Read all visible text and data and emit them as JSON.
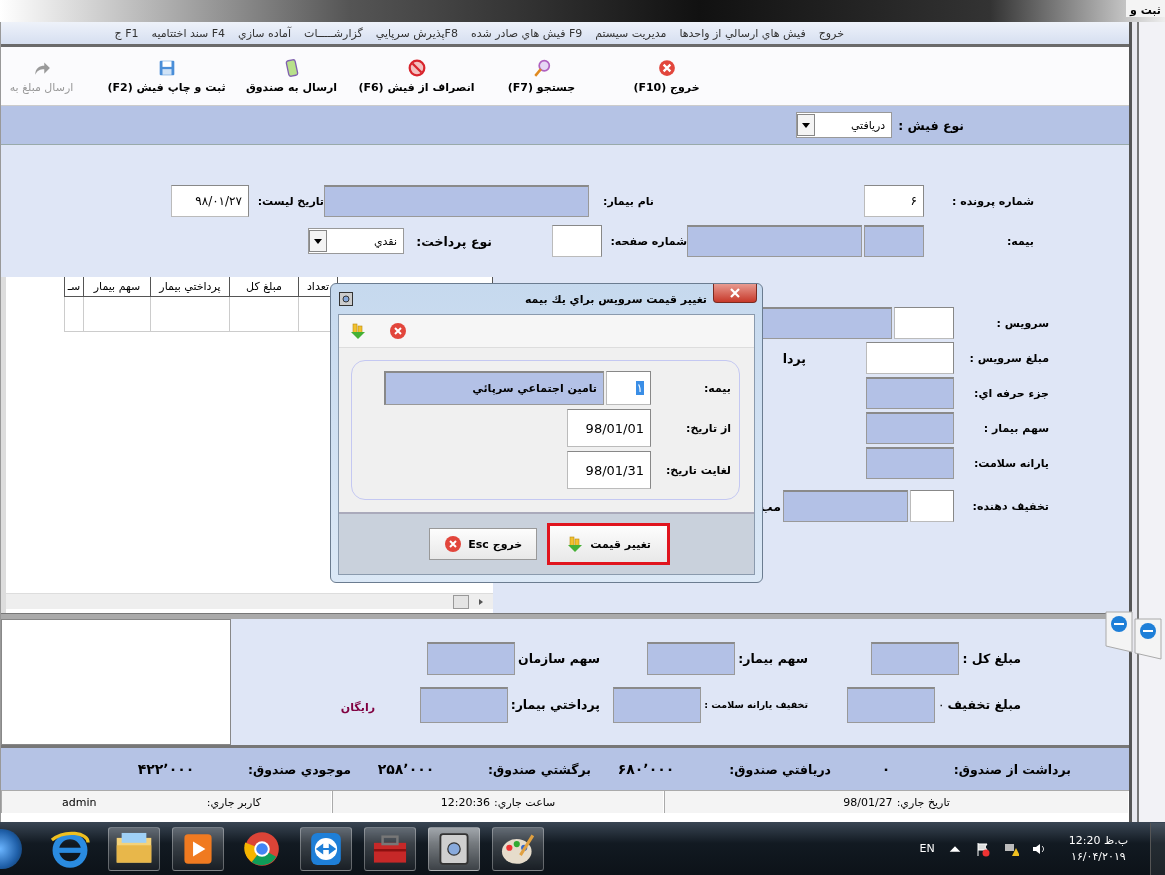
{
  "window": {
    "title": "ثبت و"
  },
  "menu": [
    "خروج",
    "فيش هاي ارسالي از واحدها",
    "مديريت سيستم",
    "F9 فيش هاي صادر شده",
    "F8پذيرش سرپايي",
    "گزارشـــــات",
    "آماده سازي",
    "F4 سند اختتاميه",
    "F1 ج"
  ],
  "toolbar": [
    {
      "label": "خروج (F10)",
      "kind": "exit",
      "disabled": false
    },
    {
      "label": "جستجو (F7)",
      "kind": "search",
      "disabled": false
    },
    {
      "label": "انصراف از فيش (F6)",
      "kind": "cancel",
      "disabled": false
    },
    {
      "label": "ارسال به صندوق",
      "kind": "send",
      "disabled": false
    },
    {
      "label": "ثبت و چاپ فيش (F2)",
      "kind": "save",
      "disabled": false
    },
    {
      "label": "ارسال مبلغ به",
      "kind": "forward",
      "disabled": true
    }
  ],
  "receipt_type": {
    "label": "نوع فيش :",
    "value": "دريافتي"
  },
  "patient": {
    "file_number": {
      "label": "شماره پرونده :",
      "value": "۶"
    },
    "name": {
      "label": "نام بيمار:"
    },
    "list_date": {
      "label": "تاريخ ليست:",
      "value": "۹۸/۰۱/۲۷"
    },
    "insurance": {
      "label": "بيمه:"
    },
    "page_number": {
      "label": "شماره صفحه:"
    },
    "payment_type": {
      "label": "نوع پرداخت:",
      "value": "نقدي"
    }
  },
  "grid": {
    "columns": [
      "تعداد",
      "مبلغ كل",
      "پرداختي بيمار",
      "سهم بيمار",
      "سـ"
    ]
  },
  "service": [
    {
      "label": "سرويس :",
      "kind": "code_name"
    },
    {
      "label": "مبلغ سرويس :",
      "kind": "input",
      "side_text": "پردا"
    },
    {
      "label": "جزء حرفه اي:",
      "kind": "readonly"
    },
    {
      "label": "سهم بيمار :",
      "kind": "readonly"
    },
    {
      "label": "يارانه سلامت:",
      "kind": "readonly"
    },
    {
      "label": "تخفيف دهنده:",
      "kind": "code_name",
      "side_text": "مب"
    }
  ],
  "dialog": {
    "title": "تغيير قيمت سرويس براي يك بيمه",
    "insurance": {
      "label": "بيمه:",
      "code": "۱",
      "code_highlighted": true,
      "name": "تامين اجتماعي سرپائي"
    },
    "from_date": {
      "label": "از تاريخ:",
      "value": "98/01/01"
    },
    "to_date": {
      "label": "لغايت تاريخ:",
      "value": "98/01/31"
    },
    "buttons": [
      {
        "label": "تغيير قيمت",
        "kind": "apply",
        "highlighted": true
      },
      {
        "label": "خروج Esc",
        "kind": "exit",
        "highlighted": false
      }
    ]
  },
  "totals": [
    {
      "label": "مبلغ كل :"
    },
    {
      "label": "سهم بيمار:"
    },
    {
      "label": "سهم سازمان"
    },
    {
      "label": "مبلغ تخفيف",
      "value": "۰"
    },
    {
      "label": "تخفيف يارانه سلامت :"
    },
    {
      "label": "پرداختي بيمار:"
    }
  ],
  "totals_note": "رايگان",
  "cash": [
    {
      "label": "برداشت از صندوق:",
      "value": "۰"
    },
    {
      "label": "دريافتي صندوق:",
      "value": "۶۸۰٬۰۰۰"
    },
    {
      "label": "برگشتي صندوق:",
      "value": "۲۵۸٬۰۰۰"
    },
    {
      "label": "موجودي صندوق:",
      "value": "۴۲۲٬۰۰۰"
    }
  ],
  "status_bar": [
    {
      "label": "تاريخ جاري:",
      "value": "98/01/27"
    },
    {
      "label": "ساعت جاري:",
      "value": "12:20:36"
    },
    {
      "label": "كاربر جاري:",
      "value": "admin"
    }
  ],
  "taskbar": {
    "language": "EN",
    "time": "12:20 ب.ظ",
    "date": "۱۶/۰۴/۲۰۱۹"
  }
}
